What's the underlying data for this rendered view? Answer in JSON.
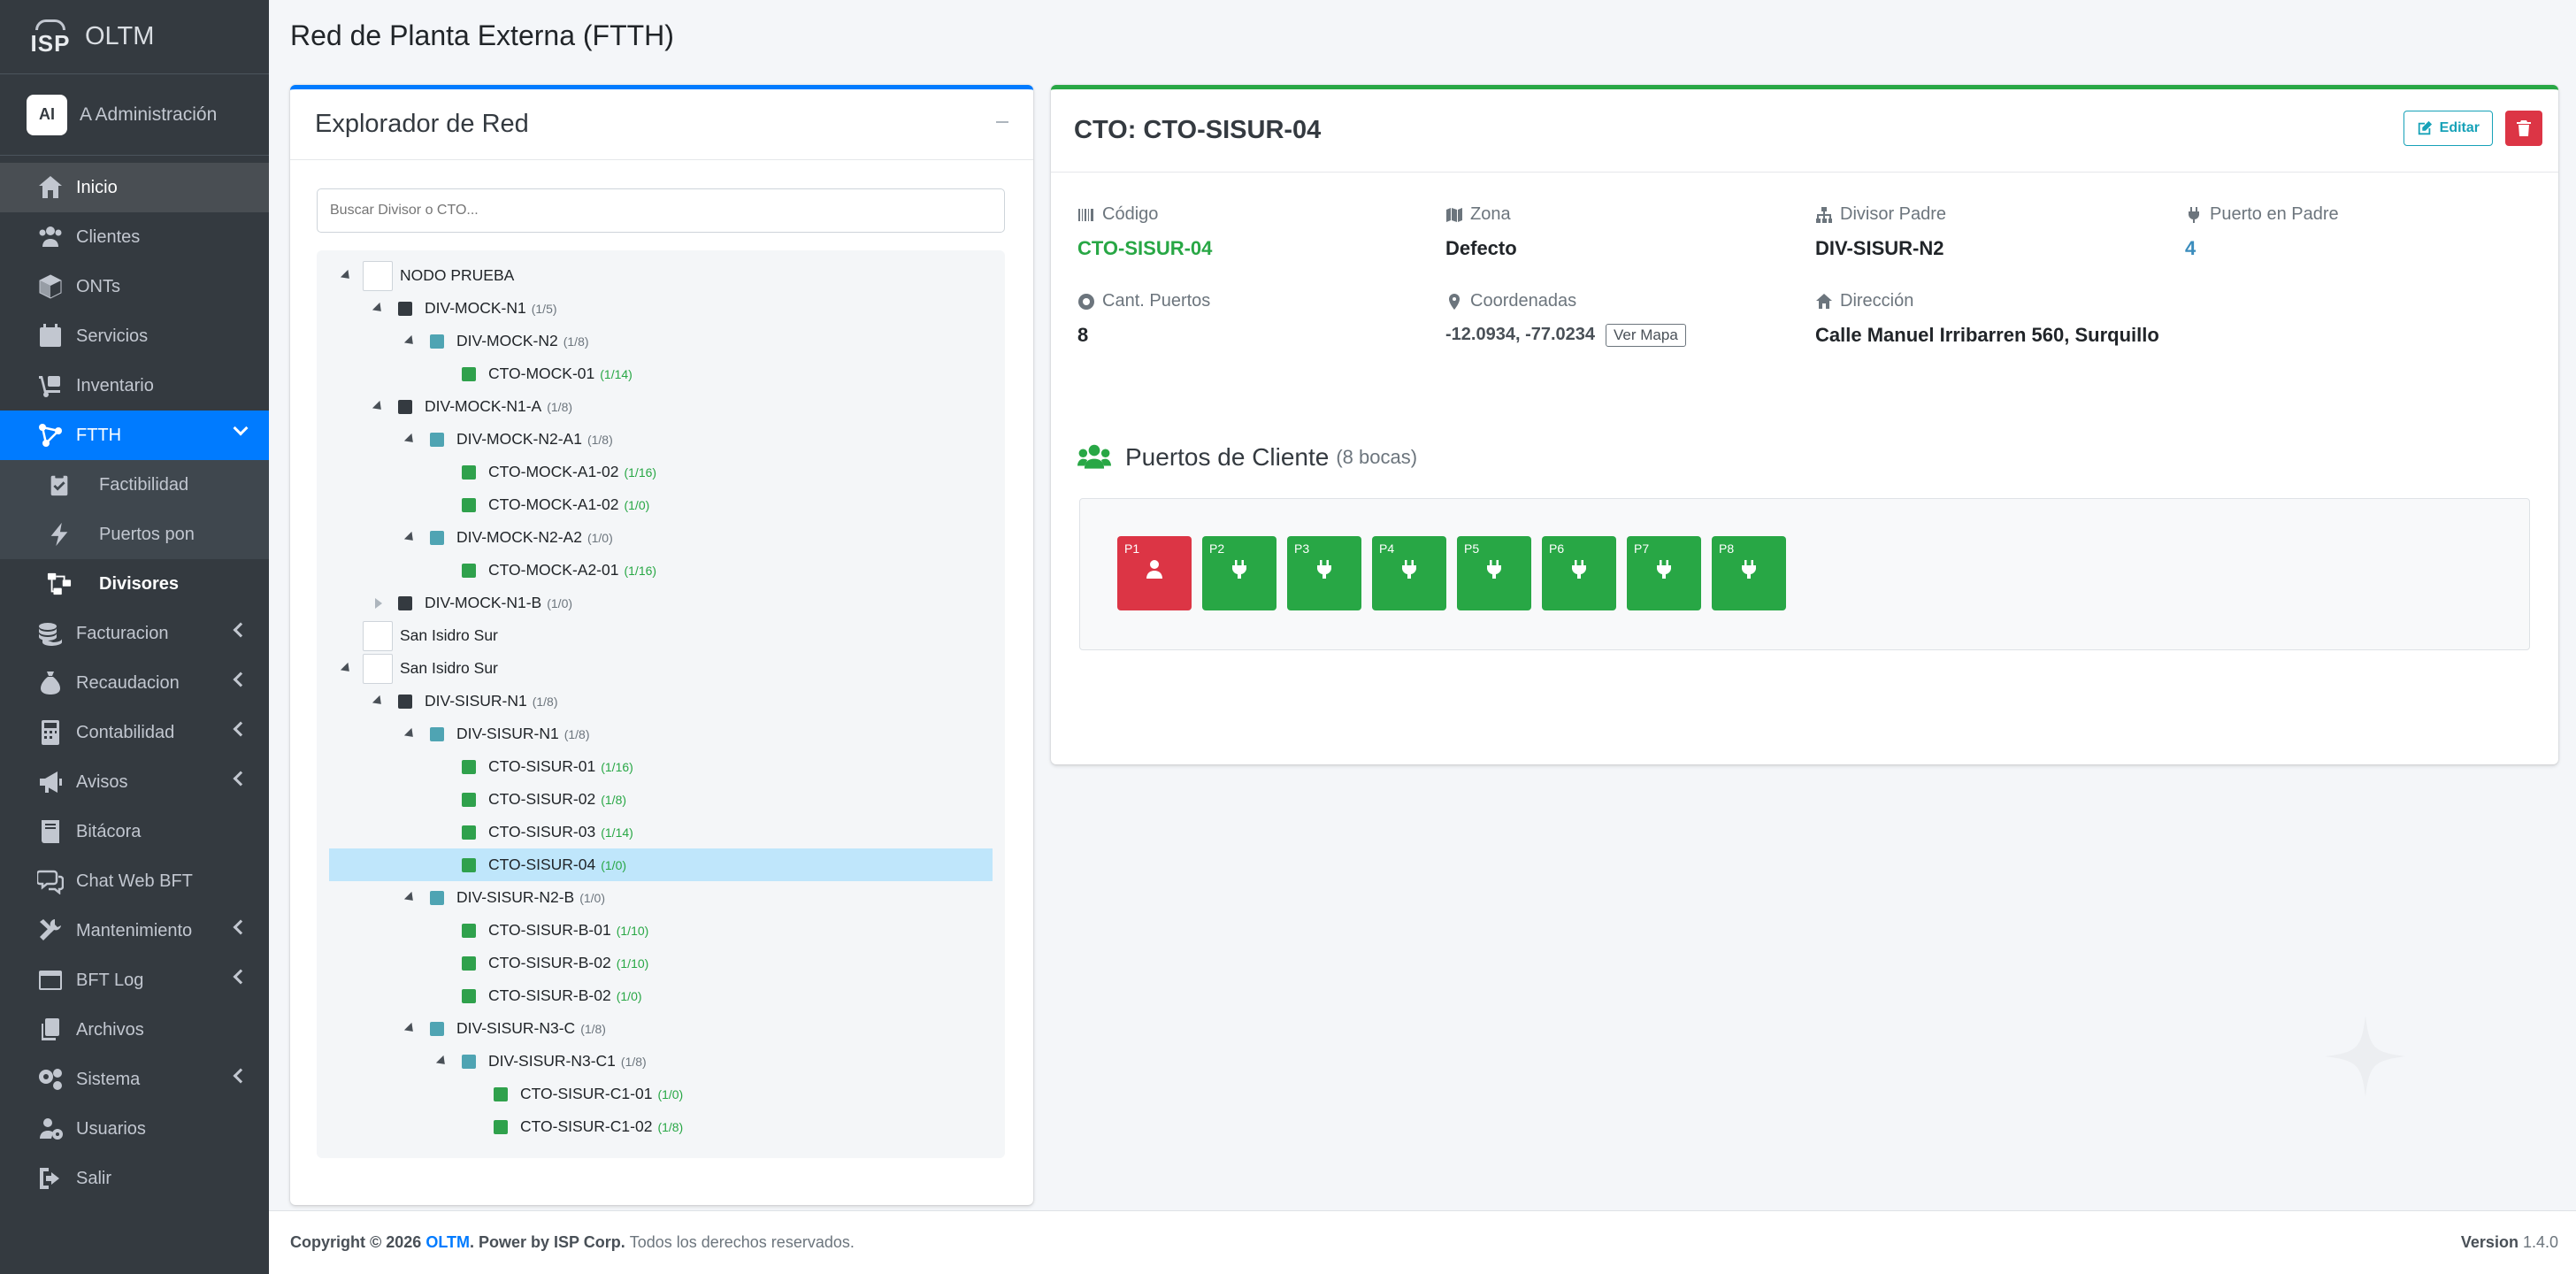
{
  "app": {
    "brand_logo": "ISP",
    "brand": "OLTM",
    "user_initials": "AI",
    "user_name": "A Administración"
  },
  "nav": [
    {
      "label": "Inicio",
      "icon": "home-icon",
      "state": "hover"
    },
    {
      "label": "Clientes",
      "icon": "users-icon"
    },
    {
      "label": "ONTs",
      "icon": "cube-icon"
    },
    {
      "label": "Servicios",
      "icon": "calendar-icon"
    },
    {
      "label": "Inventario",
      "icon": "dolly-icon"
    },
    {
      "label": "FTTH",
      "icon": "network-icon",
      "state": "active",
      "submenu": [
        {
          "label": "Factibilidad",
          "icon": "clipboard-check-icon"
        },
        {
          "label": "Puertos pon",
          "icon": "bolt-icon"
        },
        {
          "label": "Divisores",
          "icon": "project-diagram-icon",
          "current": true
        }
      ]
    },
    {
      "label": "Facturacion",
      "icon": "coins-icon",
      "caret": true
    },
    {
      "label": "Recaudacion",
      "icon": "money-bag-icon",
      "caret": true
    },
    {
      "label": "Contabilidad",
      "icon": "calculator-icon",
      "caret": true
    },
    {
      "label": "Avisos",
      "icon": "bullhorn-icon",
      "caret": true
    },
    {
      "label": "Bitácora",
      "icon": "book-icon"
    },
    {
      "label": "Chat Web BFT",
      "icon": "comments-icon"
    },
    {
      "label": "Mantenimiento",
      "icon": "tools-icon",
      "caret": true
    },
    {
      "label": "BFT Log",
      "icon": "window-icon",
      "caret": true
    },
    {
      "label": "Archivos",
      "icon": "copy-icon"
    },
    {
      "label": "Sistema",
      "icon": "cogs-icon",
      "caret": true
    },
    {
      "label": "Usuarios",
      "icon": "users-cog-icon"
    },
    {
      "label": "Salir",
      "icon": "sign-out-icon"
    }
  ],
  "page": {
    "title": "Red de Planta Externa (FTTH)"
  },
  "explorer": {
    "title": "Explorador de Red",
    "search_placeholder": "Buscar Divisor o CTO...",
    "tree": [
      {
        "label": "NODO PRUEBA",
        "level": 0,
        "kind": "node",
        "toggle": "open"
      },
      {
        "label": "DIV-MOCK-N1",
        "count": "(1/5)",
        "level": 1,
        "kind": "dark",
        "toggle": "open"
      },
      {
        "label": "DIV-MOCK-N2",
        "count": "(1/8)",
        "level": 2,
        "kind": "teal",
        "toggle": "open"
      },
      {
        "label": "CTO-MOCK-01",
        "count": "(1/14)",
        "level": 3,
        "kind": "green"
      },
      {
        "label": "DIV-MOCK-N1-A",
        "count": "(1/8)",
        "level": 1,
        "kind": "dark",
        "toggle": "open"
      },
      {
        "label": "DIV-MOCK-N2-A1",
        "count": "(1/8)",
        "level": 2,
        "kind": "teal",
        "toggle": "open"
      },
      {
        "label": "CTO-MOCK-A1-02",
        "count": "(1/16)",
        "level": 3,
        "kind": "green"
      },
      {
        "label": "CTO-MOCK-A1-02",
        "count": "(1/0)",
        "level": 3,
        "kind": "green"
      },
      {
        "label": "DIV-MOCK-N2-A2",
        "count": "(1/0)",
        "level": 2,
        "kind": "teal",
        "toggle": "open"
      },
      {
        "label": "CTO-MOCK-A2-01",
        "count": "(1/16)",
        "level": 3,
        "kind": "green"
      },
      {
        "label": "DIV-MOCK-N1-B",
        "count": "(1/0)",
        "level": 1,
        "kind": "dark",
        "toggle": "closed"
      },
      {
        "label": "San Isidro Sur",
        "level": 0,
        "kind": "node"
      },
      {
        "label": "San Isidro Sur",
        "level": 0,
        "kind": "node",
        "toggle": "open"
      },
      {
        "label": "DIV-SISUR-N1",
        "count": "(1/8)",
        "level": 1,
        "kind": "dark",
        "toggle": "open"
      },
      {
        "label": "DIV-SISUR-N1",
        "count": "(1/8)",
        "level": 2,
        "kind": "teal",
        "toggle": "open"
      },
      {
        "label": "CTO-SISUR-01",
        "count": "(1/16)",
        "level": 3,
        "kind": "green"
      },
      {
        "label": "CTO-SISUR-02",
        "count": "(1/8)",
        "level": 3,
        "kind": "green"
      },
      {
        "label": "CTO-SISUR-03",
        "count": "(1/14)",
        "level": 3,
        "kind": "green"
      },
      {
        "label": "CTO-SISUR-04",
        "count": "(1/0)",
        "level": 3,
        "kind": "green",
        "selected": true
      },
      {
        "label": "DIV-SISUR-N2-B",
        "count": "(1/0)",
        "level": 2,
        "kind": "teal",
        "toggle": "open"
      },
      {
        "label": "CTO-SISUR-B-01",
        "count": "(1/10)",
        "level": 3,
        "kind": "green"
      },
      {
        "label": "CTO-SISUR-B-02",
        "count": "(1/10)",
        "level": 3,
        "kind": "green"
      },
      {
        "label": "CTO-SISUR-B-02",
        "count": "(1/0)",
        "level": 3,
        "kind": "green"
      },
      {
        "label": "DIV-SISUR-N3-C",
        "count": "(1/8)",
        "level": 2,
        "kind": "teal",
        "toggle": "open"
      },
      {
        "label": "DIV-SISUR-N3-C1",
        "count": "(1/8)",
        "level": 3,
        "kind": "teal",
        "toggle": "open"
      },
      {
        "label": "CTO-SISUR-C1-01",
        "count": "(1/0)",
        "level": 4,
        "kind": "green"
      },
      {
        "label": "CTO-SISUR-C1-02",
        "count": "(1/8)",
        "level": 4,
        "kind": "green"
      }
    ]
  },
  "detail": {
    "title": "CTO: CTO-SISUR-04",
    "edit_label": "Editar",
    "codigo_label": "Código",
    "codigo": "CTO-SISUR-04",
    "zona_label": "Zona",
    "zona": "Defecto",
    "divisor_label": "Divisor Padre",
    "divisor": "DIV-SISUR-N2",
    "puerto_label": "Puerto en Padre",
    "puerto": "4",
    "cant_label": "Cant. Puertos",
    "cant": "8",
    "coord_label": "Coordenadas",
    "coord": "-12.0934, -77.0234",
    "ver_mapa": "Ver Mapa",
    "dir_label": "Dirección",
    "dir": "Calle Manuel Irribarren 560, Surquillo",
    "ports_title": "Puertos de Cliente",
    "ports_sub": "(8 bocas)",
    "ports": [
      {
        "label": "P1",
        "status": "occupied"
      },
      {
        "label": "P2",
        "status": "free"
      },
      {
        "label": "P3",
        "status": "free"
      },
      {
        "label": "P4",
        "status": "free"
      },
      {
        "label": "P5",
        "status": "free"
      },
      {
        "label": "P6",
        "status": "free"
      },
      {
        "label": "P7",
        "status": "free"
      },
      {
        "label": "P8",
        "status": "free"
      }
    ]
  },
  "footer": {
    "copyright": "Copyright © 2026",
    "brand": "OLTM",
    "power": ". Power by ISP Corp.",
    "rights": "Todos los derechos reservados.",
    "version_label": "Version",
    "version": "1.4.0"
  },
  "colors": {
    "sidebar": "#343a40",
    "active": "#007bff",
    "success": "#28a745",
    "danger": "#dc3545",
    "info": "#17a2b8"
  }
}
